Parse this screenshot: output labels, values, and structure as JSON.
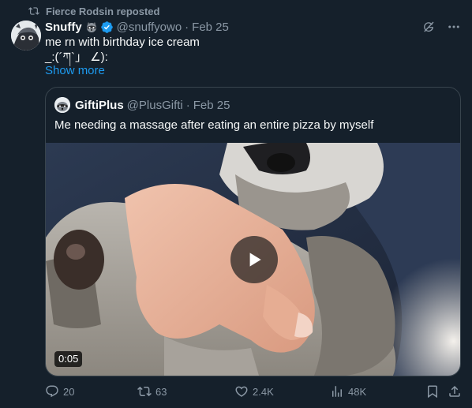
{
  "repost": {
    "label": "Fierce Rodsin reposted",
    "icon": "repost-icon"
  },
  "tweet": {
    "display_name": "Snuffy",
    "name_emoji": "raccoon-emoji",
    "verified": true,
    "handle": "@snuffyowo",
    "separator": "·",
    "date": "Feb 25",
    "text_line1": "me rn with birthday ice cream",
    "text_line2": "_:(´ཀ`」 ∠):",
    "show_more": "Show more"
  },
  "quote": {
    "display_name": "GiftiPlus",
    "handle": "@PlusGifti",
    "separator": "·",
    "date": "Feb 25",
    "text": "Me needing a massage after eating an entire pizza by myself",
    "video_duration": "0:05"
  },
  "actions": {
    "replies": "20",
    "reposts": "63",
    "likes": "2.4K",
    "views": "48K"
  },
  "colors": {
    "background": "#15202b",
    "text": "#f7f9f9",
    "secondary": "#8b98a5",
    "link": "#1d9bf0",
    "border": "#38444d",
    "verified": "#1d9bf0"
  }
}
